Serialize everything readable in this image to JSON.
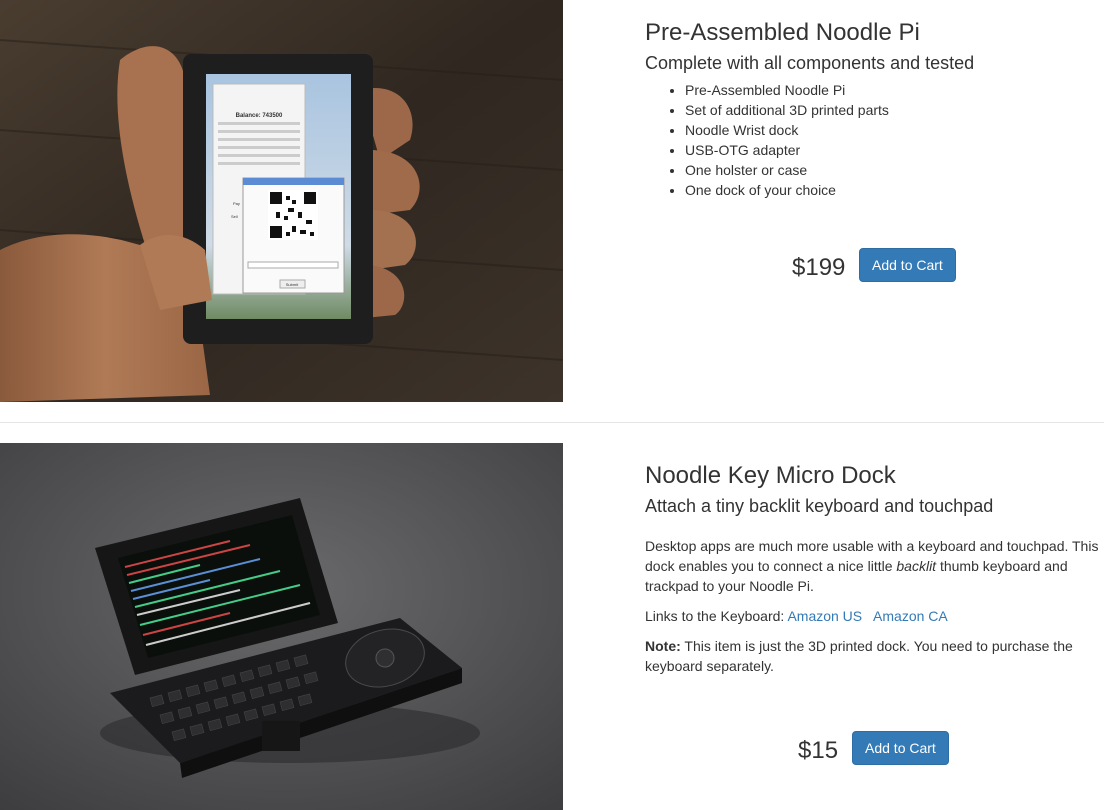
{
  "products": [
    {
      "title": "Pre-Assembled Noodle Pi",
      "subtitle": "Complete with all components and tested",
      "features": [
        "Pre-Assembled Noodle Pi",
        "Set of additional 3D printed parts",
        "Noodle Wrist dock",
        "USB-OTG adapter",
        "One holster or case",
        "One dock of your choice"
      ],
      "price": "$199",
      "button_label": "Add to Cart",
      "photo": {
        "screen_balance": "Balance: 743500",
        "screen_button_pay": "Pay",
        "screen_button_sell": "Sell",
        "screen_button_ok": "Submit"
      }
    },
    {
      "title": "Noodle Key Micro Dock",
      "subtitle": "Attach a tiny backlit keyboard and touchpad",
      "desc_part1": "Desktop apps are much more usable with a keyboard and touchpad. This dock enables you to connect a nice little ",
      "desc_em": "backlit",
      "desc_part2": " thumb keyboard and trackpad to your Noodle Pi.",
      "links_label": "Links to the Keyboard: ",
      "link_us": "Amazon US",
      "link_ca": "Amazon CA",
      "note_label": "Note:",
      "note_text": " This item is just the 3D printed dock. You need to purchase the keyboard separately.",
      "price": "$15",
      "button_label": "Add to Cart"
    }
  ],
  "colors": {
    "link": "#337ab7",
    "button": "#337ab7",
    "text": "#333333"
  }
}
